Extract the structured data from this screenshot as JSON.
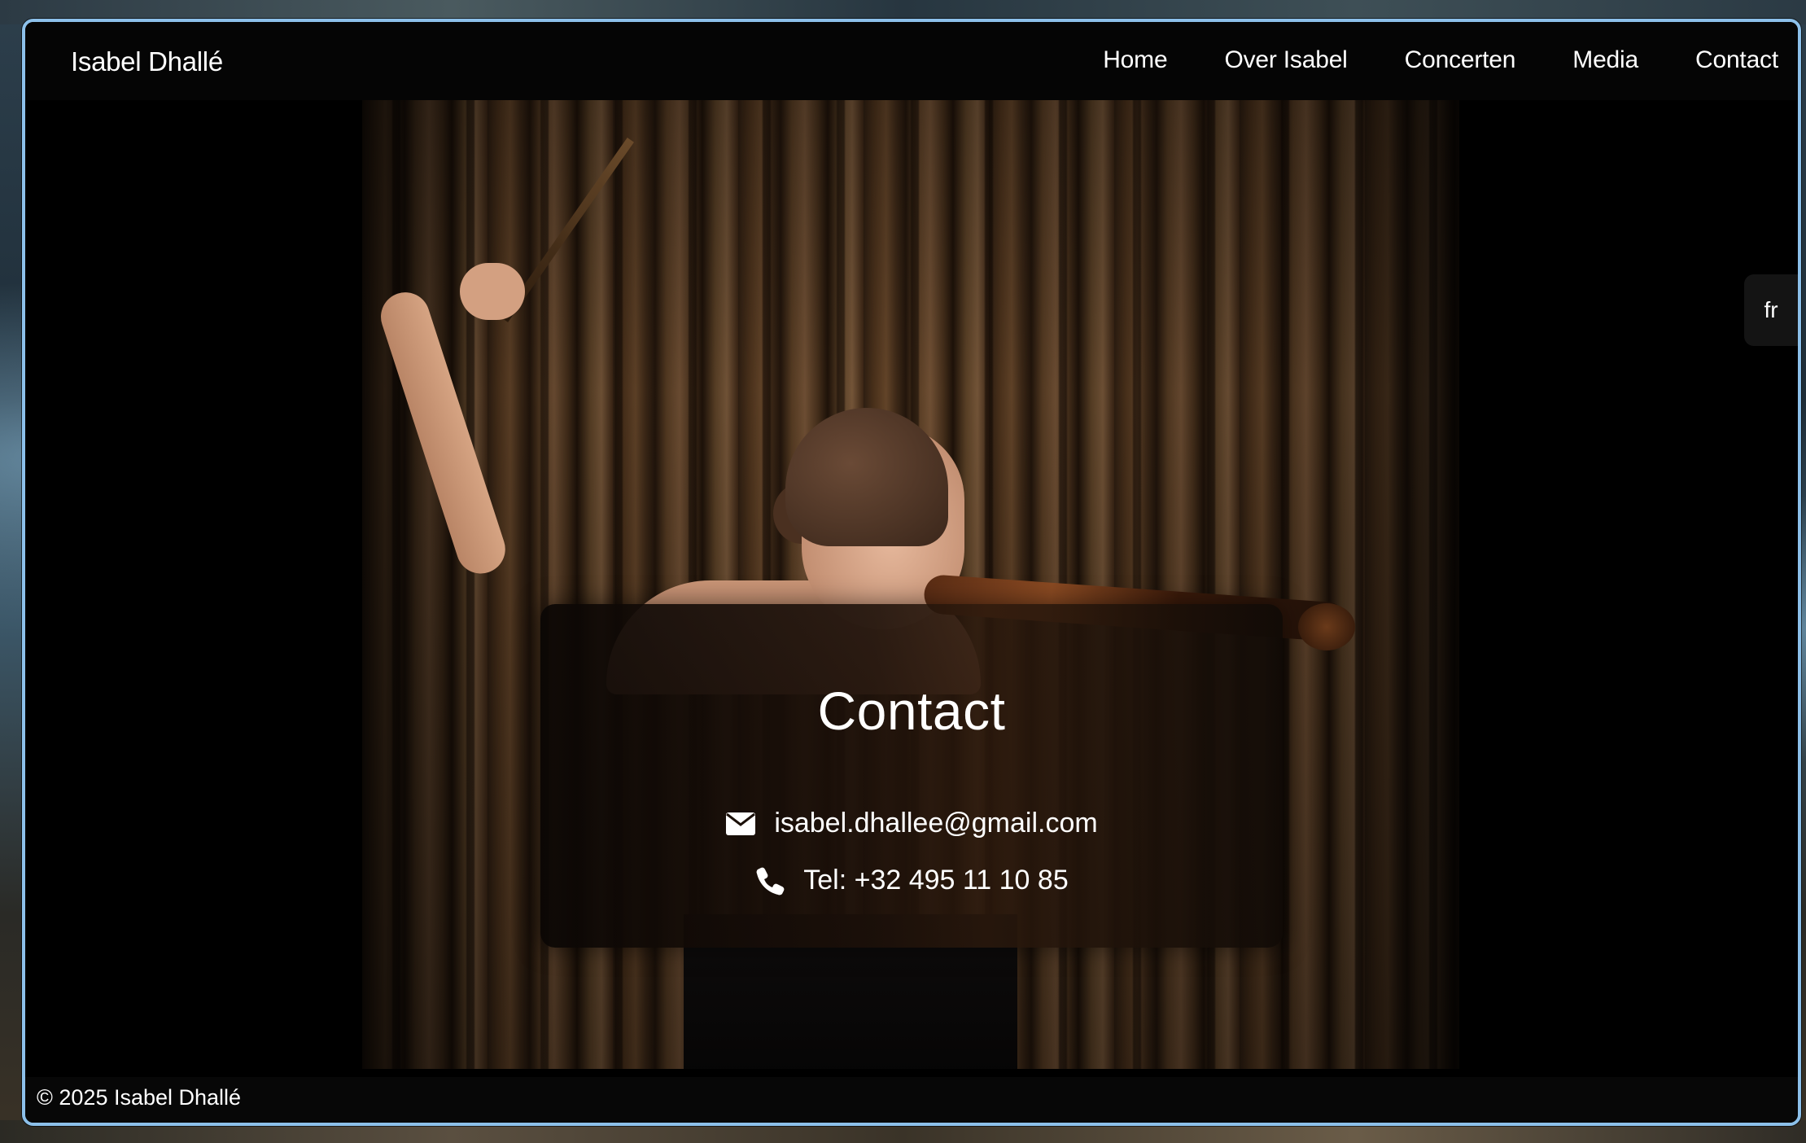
{
  "brand": {
    "name": "Isabel Dhallé"
  },
  "nav": {
    "items": [
      {
        "label": "Home"
      },
      {
        "label": "Over Isabel"
      },
      {
        "label": "Concerten"
      },
      {
        "label": "Media"
      },
      {
        "label": "Contact"
      }
    ]
  },
  "language_toggle": {
    "label": "fr"
  },
  "contact_card": {
    "title": "Contact",
    "email": {
      "icon": "envelope-icon",
      "text": "isabel.dhallee@gmail.com"
    },
    "phone": {
      "icon": "phone-icon",
      "text": "Tel: +32 495 11 10 85"
    }
  },
  "footer": {
    "copyright": "© 2025 Isabel Dhallé"
  },
  "colors": {
    "frame_border": "#8cc0ea",
    "page_background": "#000000",
    "text": "#ffffff",
    "card_background": "#1a0f08"
  }
}
